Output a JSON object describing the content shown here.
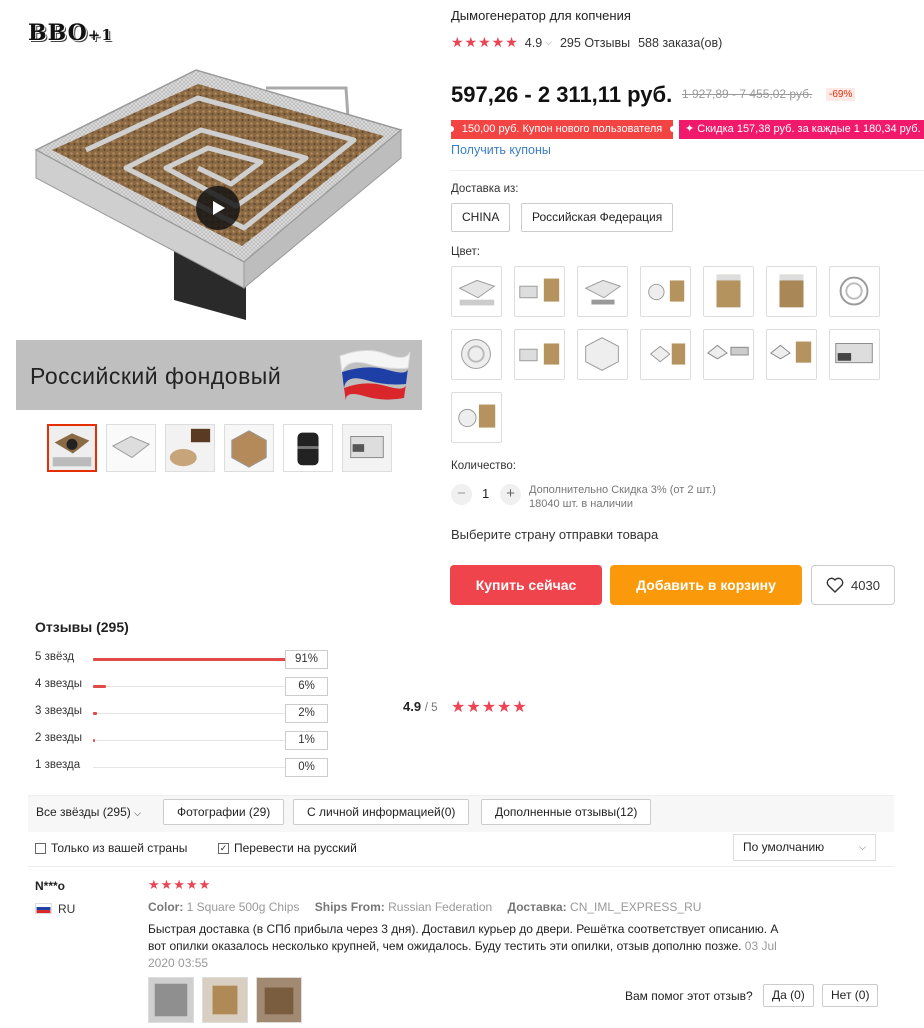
{
  "brand": {
    "logo_main": "BBO",
    "logo_suffix": "+1"
  },
  "gallery": {
    "banner_text": "Российский фондовый",
    "thumbnail_count": 6
  },
  "product": {
    "title": "Дымогенератор для копчения",
    "rating_value": "4.9",
    "reviews_count": "295 Отзывы",
    "orders_count": "588 заказа(ов)",
    "price": "597,26 - 2 311,11 руб.",
    "old_price": "1 927,89 - 7 455,02 руб.",
    "discount": "-69%",
    "coupon_new_user": "150,00 руб. Купон нового пользователя",
    "coupon_discount": "✦ Скидка 157,38 руб. за каждые 1 180,34 руб.",
    "get_coupons": "Получить купоны"
  },
  "shipping": {
    "label": "Доставка из:",
    "options": [
      "CHINA",
      "Российская Федерация"
    ]
  },
  "color": {
    "label": "Цвет:",
    "swatch_count": 15
  },
  "quantity": {
    "label": "Количество:",
    "minus": "−",
    "value": "1",
    "plus": "+",
    "note_line1": "Дополнительно Скидка 3% (от 2 шт.)",
    "note_line2": "18040 шт. в наличии"
  },
  "ship_country_prompt": "Выберите страну отправки товара",
  "actions": {
    "buy_now": "Купить сейчас",
    "add_to_cart": "Добавить в корзину",
    "wishlist_count": "4030"
  },
  "reviews": {
    "title": "Отзывы (295)",
    "histogram": [
      {
        "label": "5 звёзд",
        "percent": 91,
        "text": "91%"
      },
      {
        "label": "4 звезды",
        "percent": 6,
        "text": "6%"
      },
      {
        "label": "3 звезды",
        "percent": 2,
        "text": "2%"
      },
      {
        "label": "2 звезды",
        "percent": 1,
        "text": "1%"
      },
      {
        "label": "1 звезда",
        "percent": 0,
        "text": "0%"
      }
    ],
    "score": "4.9",
    "score_out_of": "/ 5",
    "filters": {
      "all": "Все звёзды (295)",
      "photos": "Фотографии (29)",
      "personal": "С личной информацией(0)",
      "extra": "Дополненные отзывы(12)",
      "only_country": "Только из вашей страны",
      "translate": "Перевести на русский",
      "sort": "По умолчанию"
    },
    "items": [
      {
        "name": "N***o",
        "country": "RU",
        "color_label": "Color:",
        "color_value": "1 Square 500g Chips",
        "ships_label": "Ships From:",
        "ships_value": "Russian Federation",
        "delivery_label": "Доставка:",
        "delivery_value": "CN_IML_EXPRESS_RU",
        "text": "Быстрая доставка (в СПб прибыла через 3 дня). Доставил курьер до двери. Решётка соответствует описанию. А вот опилки оказалось несколько крупней, чем ожидалось. Буду тестить эти опилки, отзыв дополню позже.",
        "date": "03 Jul 2020 03:55",
        "helpful_prompt": "Вам помог этот отзыв?",
        "yes": "Да (0)",
        "no": "Нет (0)"
      }
    ]
  },
  "colors": {
    "accent_red": "#f0444d",
    "cart_orange": "#fa9a0a",
    "star": "#ec4454",
    "link": "#3b7ec4",
    "coupon_red": "#f24443",
    "coupon_pink": "#f0196b"
  }
}
